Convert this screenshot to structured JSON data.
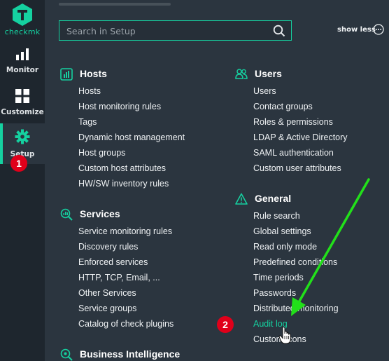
{
  "brand": {
    "name": "checkmk",
    "accent_color": "#15d1a0",
    "logo_icon": "checkmk-logo-icon"
  },
  "sidebar": {
    "items": [
      {
        "label": "Monitor",
        "icon": "bar-chart-icon"
      },
      {
        "label": "Customize",
        "icon": "grid-icon"
      },
      {
        "label": "Setup",
        "icon": "gear-icon",
        "active": true
      }
    ]
  },
  "search": {
    "placeholder": "Search in Setup",
    "icon": "search-icon"
  },
  "toggle": {
    "label": "show less",
    "icon": "more-horizontal-circle-icon"
  },
  "annotations": {
    "badge_1": "1",
    "badge_2": "2",
    "badge_color": "#e0001a",
    "arrow_color": "#22e01a"
  },
  "sections": {
    "hosts": {
      "title": "Hosts",
      "icon": "hosts-icon",
      "items": [
        "Hosts",
        "Host monitoring rules",
        "Tags",
        "Dynamic host management",
        "Host groups",
        "Custom host attributes",
        "HW/SW inventory rules"
      ]
    },
    "services": {
      "title": "Services",
      "icon": "services-icon",
      "items": [
        "Service monitoring rules",
        "Discovery rules",
        "Enforced services",
        "HTTP, TCP, Email, ...",
        "Other Services",
        "Service groups",
        "Catalog of check plugins"
      ]
    },
    "bi": {
      "title": "Business Intelligence",
      "icon": "business-intelligence-icon"
    },
    "users": {
      "title": "Users",
      "icon": "users-icon",
      "items": [
        "Users",
        "Contact groups",
        "Roles & permissions",
        "LDAP & Active Directory",
        "SAML authentication",
        "Custom user attributes"
      ]
    },
    "general": {
      "title": "General",
      "icon": "warning-triangle-icon",
      "items": [
        "Rule search",
        "Global settings",
        "Read only mode",
        "Predefined conditions",
        "Time periods",
        "Passwords",
        "Distributed monitoring",
        "Audit log",
        "Custom icons"
      ],
      "active_item": "Audit log"
    }
  }
}
